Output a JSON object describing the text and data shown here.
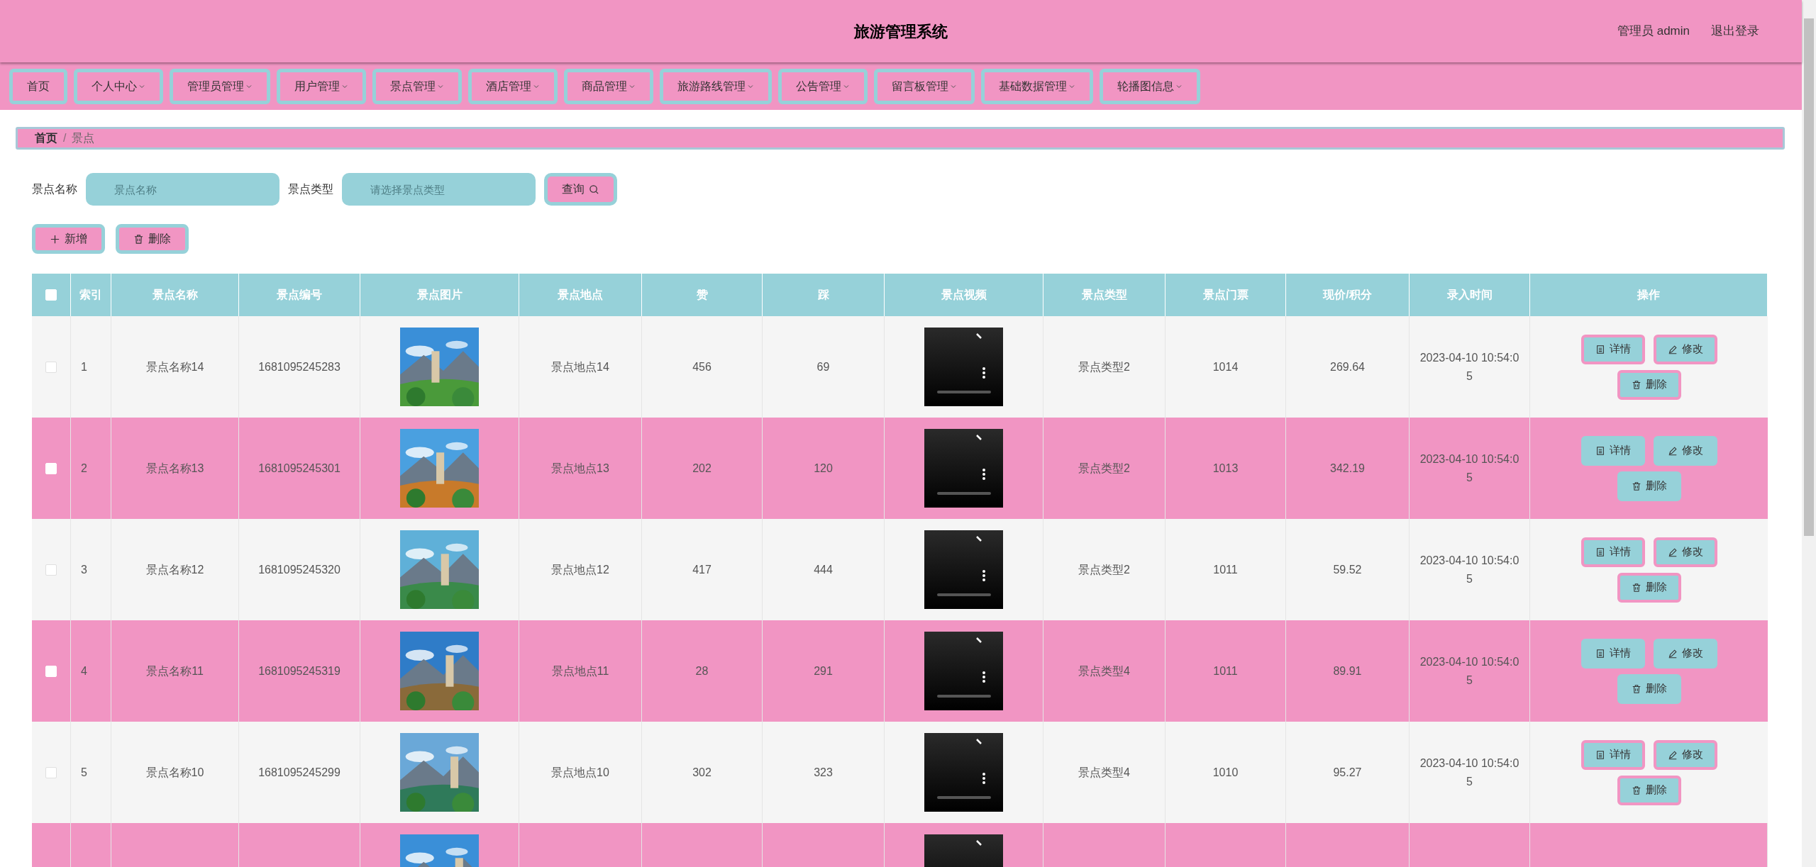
{
  "header": {
    "title": "旅游管理系统",
    "user": "管理员 admin",
    "logout": "退出登录"
  },
  "nav": [
    {
      "label": "首页",
      "dropdown": false
    },
    {
      "label": "个人中心",
      "dropdown": true
    },
    {
      "label": "管理员管理",
      "dropdown": true
    },
    {
      "label": "用户管理",
      "dropdown": true
    },
    {
      "label": "景点管理",
      "dropdown": true
    },
    {
      "label": "酒店管理",
      "dropdown": true
    },
    {
      "label": "商品管理",
      "dropdown": true
    },
    {
      "label": "旅游路线管理",
      "dropdown": true
    },
    {
      "label": "公告管理",
      "dropdown": true
    },
    {
      "label": "留言板管理",
      "dropdown": true
    },
    {
      "label": "基础数据管理",
      "dropdown": true
    },
    {
      "label": "轮播图信息",
      "dropdown": true
    }
  ],
  "breadcrumb": {
    "items": [
      "首页",
      "景点"
    ],
    "separator": "/"
  },
  "search": [
    {
      "label": "景点名称",
      "placeholder": "景点名称"
    },
    {
      "label": "景点类型",
      "placeholder": "请选择景点类型"
    }
  ],
  "search_button": "查询",
  "actions": [
    {
      "kind": "add",
      "label": "新增"
    },
    {
      "kind": "delete",
      "label": "删除"
    }
  ],
  "table": {
    "columns": [
      "索引",
      "景点名称",
      "景点编号",
      "景点图片",
      "景点地点",
      "赞",
      "踩",
      "景点视频",
      "景点类型",
      "景点门票",
      "现价/积分",
      "录入时间",
      "操作"
    ],
    "select_all_checked": false,
    "rows": [
      {
        "index": "1",
        "name": "景点名称14",
        "code": "1681095245283",
        "place": "景点地点14",
        "likes": "456",
        "dislikes": "69",
        "type": "景点类型2",
        "ticket": "1014",
        "price": "269.64",
        "time": "2023-04-10 10:54:05",
        "checked": false,
        "buttons": [
          {
            "kind": "detail",
            "label": "详情"
          },
          {
            "kind": "edit",
            "label": "修改"
          },
          {
            "kind": "delete",
            "label": "删除"
          }
        ]
      },
      {
        "index": "2",
        "name": "景点名称13",
        "code": "1681095245301",
        "place": "景点地点13",
        "likes": "202",
        "dislikes": "120",
        "type": "景点类型2",
        "ticket": "1013",
        "price": "342.19",
        "time": "2023-04-10 10:54:05",
        "checked": false,
        "buttons": [
          {
            "kind": "detail",
            "label": "详情"
          },
          {
            "kind": "edit",
            "label": "修改"
          },
          {
            "kind": "delete",
            "label": "删除"
          }
        ]
      },
      {
        "index": "3",
        "name": "景点名称12",
        "code": "1681095245320",
        "place": "景点地点12",
        "likes": "417",
        "dislikes": "444",
        "type": "景点类型2",
        "ticket": "1011",
        "price": "59.52",
        "time": "2023-04-10 10:54:05",
        "checked": false,
        "buttons": [
          {
            "kind": "detail",
            "label": "详情"
          },
          {
            "kind": "edit",
            "label": "修改"
          },
          {
            "kind": "delete",
            "label": "删除"
          }
        ]
      },
      {
        "index": "4",
        "name": "景点名称11",
        "code": "1681095245319",
        "place": "景点地点11",
        "likes": "28",
        "dislikes": "291",
        "type": "景点类型4",
        "ticket": "1011",
        "price": "89.91",
        "time": "2023-04-10 10:54:05",
        "checked": false,
        "buttons": [
          {
            "kind": "detail",
            "label": "详情"
          },
          {
            "kind": "edit",
            "label": "修改"
          },
          {
            "kind": "delete",
            "label": "删除"
          }
        ]
      },
      {
        "index": "5",
        "name": "景点名称10",
        "code": "1681095245299",
        "place": "景点地点10",
        "likes": "302",
        "dislikes": "323",
        "type": "景点类型4",
        "ticket": "1010",
        "price": "95.27",
        "time": "2023-04-10 10:54:05",
        "checked": false,
        "buttons": [
          {
            "kind": "detail",
            "label": "详情"
          },
          {
            "kind": "edit",
            "label": "修改"
          },
          {
            "kind": "delete",
            "label": "删除"
          }
        ]
      }
    ]
  }
}
